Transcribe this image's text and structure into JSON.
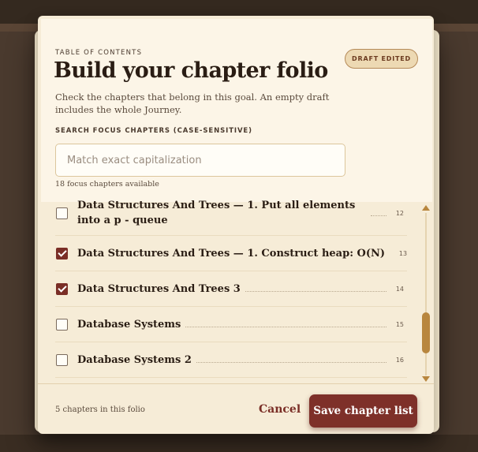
{
  "modal": {
    "eyebrow": "TABLE OF CONTENTS",
    "title": "Build your chapter folio",
    "badge": "DRAFT EDITED",
    "description": "Check the chapters that belong in this goal. An empty draft includes the whole Journey.",
    "search": {
      "label": "SEARCH FOCUS CHAPTERS (CASE-SENSITIVE)",
      "placeholder": "Match exact capitalization",
      "value": "",
      "count_text": "18 focus chapters available"
    },
    "chapters": [
      {
        "label": "Data Structures And Trees — 1. Put all elements into a p - queue",
        "page": "12",
        "checked": false
      },
      {
        "label": "Data Structures And Trees — 1. Construct heap: O(N)",
        "page": "13",
        "checked": true
      },
      {
        "label": "Data Structures And Trees 3",
        "page": "14",
        "checked": true
      },
      {
        "label": "Database Systems",
        "page": "15",
        "checked": false
      },
      {
        "label": "Database Systems 2",
        "page": "16",
        "checked": false
      }
    ],
    "footer": {
      "count_text": "5 chapters in this folio",
      "cancel_label": "Cancel",
      "save_label": "Save chapter list"
    }
  },
  "colors": {
    "accent": "#7e3029",
    "scrollbar": "#b8863e",
    "modal_bg": "#f6ecd7"
  }
}
